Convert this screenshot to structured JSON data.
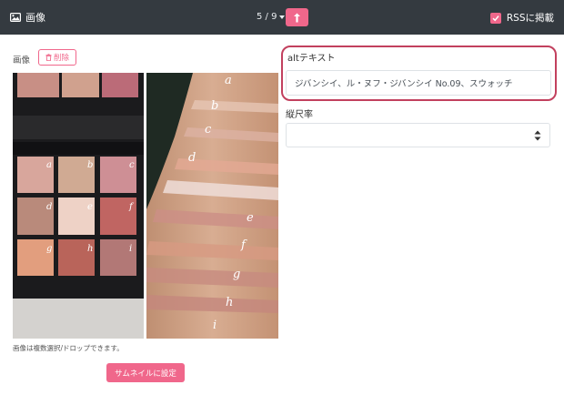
{
  "header": {
    "title": "画像",
    "pager": "5 / 9",
    "rss_label": "RSSに掲載",
    "rss_checked": true
  },
  "image_panel": {
    "label": "画像",
    "delete_label": "削除",
    "palette_letters": [
      "a",
      "b",
      "c",
      "d",
      "e",
      "f",
      "g",
      "h",
      "i"
    ],
    "swatch_letters": [
      "a",
      "b",
      "c",
      "d",
      "e",
      "f",
      "g",
      "h",
      "i"
    ],
    "note": "画像は複数選択/ドロップできます。",
    "thumbnail_button": "サムネイルに設定"
  },
  "form": {
    "alt_label": "altテキスト",
    "alt_value": "ジバンシイ、ル・ヌフ・ジバンシイ No.09、スウォッチ",
    "ratio_label": "縦尺率",
    "ratio_value": ""
  },
  "colors": {
    "accent": "#f0678b",
    "topbar": "#343a40",
    "highlight_border": "#c2405e"
  }
}
